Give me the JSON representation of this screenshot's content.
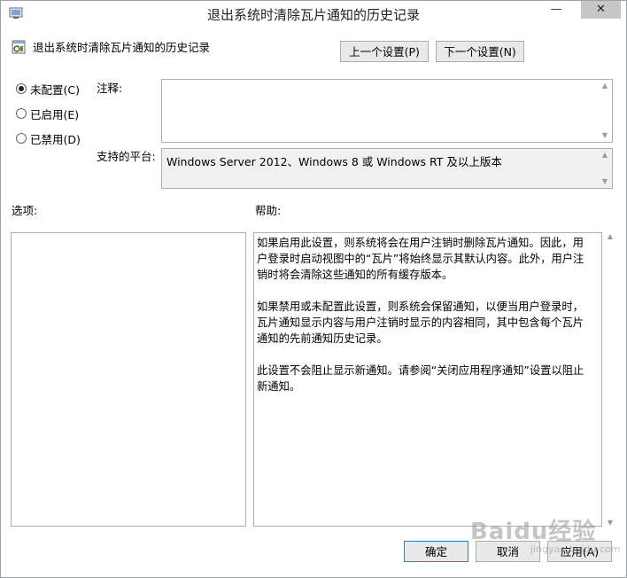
{
  "window": {
    "title": "退出系统时清除瓦片通知的历史记录",
    "icon": "policy-window-icon",
    "minimize_glyph": "—",
    "close_glyph": "✕"
  },
  "policy": {
    "name": "退出系统时清除瓦片通知的历史记录",
    "icon": "policy-settings-icon"
  },
  "nav": {
    "prev_label": "上一个设置(P)",
    "next_label": "下一个设置(N)"
  },
  "state": {
    "options": [
      {
        "label": "未配置(C)",
        "selected": true
      },
      {
        "label": "已启用(E)",
        "selected": false
      },
      {
        "label": "已禁用(D)",
        "selected": false
      }
    ]
  },
  "comment": {
    "label": "注释:",
    "value": ""
  },
  "platform": {
    "label": "支持的平台:",
    "value": "Windows Server 2012、Windows 8 或 Windows RT 及以上版本"
  },
  "options_section": {
    "label": "选项:"
  },
  "help_section": {
    "label": "帮助:",
    "paragraphs": [
      "如果启用此设置，则系统将会在用户注销时删除瓦片通知。因此，用户登录时启动视图中的“瓦片”将始终显示其默认内容。此外，用户注销时将会清除这些通知的所有缓存版本。",
      "如果禁用或未配置此设置，则系统会保留通知，以便当用户登录时，瓦片通知显示内容与用户注销时显示的内容相同，其中包含每个瓦片通知的先前通知历史记录。",
      "此设置不会阻止显示新通知。请参阅“关闭应用程序通知”设置以阻止新通知。"
    ]
  },
  "footer": {
    "ok_label": "确定",
    "cancel_label": "取消",
    "apply_label": "应用(A)"
  },
  "watermark": {
    "text": "Baidu经验",
    "sub": "jingyan.baidu.com"
  },
  "colors": {
    "default_button_border": "#3c7fb1",
    "close_button_bg": "#c7c7c7"
  }
}
